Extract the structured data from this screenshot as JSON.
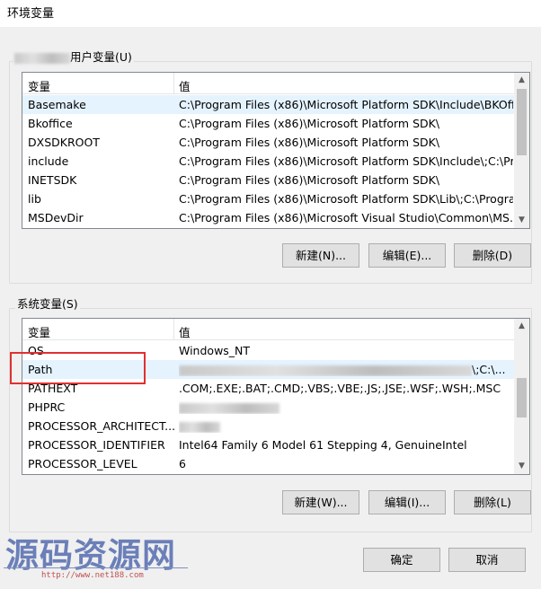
{
  "window": {
    "title": "环境变量"
  },
  "user_vars": {
    "group_label": "用户变量(U)",
    "columns": [
      "变量",
      "值"
    ],
    "rows": [
      {
        "name": "Basemake",
        "value": "C:\\Program Files (x86)\\Microsoft Platform SDK\\Include\\BKOff..."
      },
      {
        "name": "Bkoffice",
        "value": "C:\\Program Files (x86)\\Microsoft Platform SDK\\"
      },
      {
        "name": "DXSDKROOT",
        "value": "C:\\Program Files (x86)\\Microsoft Platform SDK\\"
      },
      {
        "name": "include",
        "value": "C:\\Program Files (x86)\\Microsoft Platform SDK\\Include\\;C:\\Pr..."
      },
      {
        "name": "INETSDK",
        "value": "C:\\Program Files (x86)\\Microsoft Platform SDK\\"
      },
      {
        "name": "lib",
        "value": "C:\\Program Files (x86)\\Microsoft Platform SDK\\Lib\\;C:\\Progra..."
      },
      {
        "name": "MSDevDir",
        "value": "C:\\Program Files (x86)\\Microsoft Visual Studio\\Common\\MS..."
      }
    ],
    "buttons": {
      "new": "新建(N)...",
      "edit": "编辑(E)...",
      "delete": "删除(D)"
    }
  },
  "system_vars": {
    "group_label": "系统变量(S)",
    "columns": [
      "变量",
      "值"
    ],
    "rows": [
      {
        "name": "OS",
        "value": "Windows_NT"
      },
      {
        "name": "Path",
        "value": "\\;C:\\..."
      },
      {
        "name": "PATHEXT",
        "value": ".COM;.EXE;.BAT;.CMD;.VBS;.VBE;.JS;.JSE;.WSF;.WSH;.MSC"
      },
      {
        "name": "PHPRC",
        "value": ""
      },
      {
        "name": "PROCESSOR_ARCHITECT...",
        "value": ""
      },
      {
        "name": "PROCESSOR_IDENTIFIER",
        "value": "Intel64 Family 6 Model 61 Stepping 4, GenuineIntel"
      },
      {
        "name": "PROCESSOR_LEVEL",
        "value": "6"
      }
    ],
    "buttons": {
      "new": "新建(W)...",
      "edit": "编辑(I)...",
      "delete": "删除(L)"
    }
  },
  "footer": {
    "ok": "确定",
    "cancel": "取消"
  },
  "watermark": {
    "text": "源码资源网",
    "url": "http://www.net188.com"
  },
  "colors": {
    "highlight_box": "#e03030",
    "selection": "#e5f3ff"
  }
}
